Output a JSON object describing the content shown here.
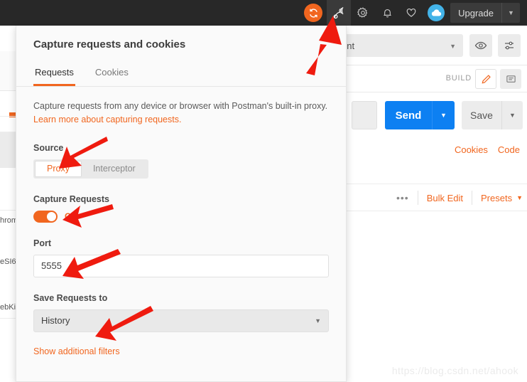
{
  "topbar": {
    "icons": [
      {
        "name": "sync-icon",
        "glyph": "sync"
      },
      {
        "name": "capture-requests-icon",
        "glyph": "satellite"
      },
      {
        "name": "settings-gear-icon",
        "glyph": "gear"
      },
      {
        "name": "notifications-bell-icon",
        "glyph": "bell"
      },
      {
        "name": "favorites-heart-icon",
        "glyph": "heart"
      },
      {
        "name": "account-avatar",
        "glyph": "cloud"
      }
    ],
    "upgrade_label": "Upgrade",
    "upgrade_caret": "▼",
    "colors": {
      "bar_bg": "#282828",
      "sync_orange": "#f1661f",
      "avatar_blue": "#43b3e8"
    }
  },
  "envbar": {
    "environment_text": "vironment",
    "caret": "▼",
    "eye_icon": "eye-icon",
    "sliders_icon": "sliders-icon"
  },
  "buildrow": {
    "build_label": "BUILD",
    "pencil_icon": "pencil-icon",
    "comment_icon": "comment-icon"
  },
  "sendrow": {
    "send_label": "Send",
    "send_caret": "▼",
    "save_label": "Save",
    "save_caret": "▼",
    "links": [
      "Cookies",
      "Code"
    ]
  },
  "paramsrow": {
    "dots": "•••",
    "bulk_edit": "Bulk Edit",
    "presets": "Presets",
    "presets_caret": "▼"
  },
  "left_sliver": {
    "fragments": [
      "hrom",
      "eSI6",
      "ebKit"
    ]
  },
  "modal": {
    "title": "Capture requests and cookies",
    "tabs": [
      {
        "label": "Requests",
        "selected": true
      },
      {
        "label": "Cookies",
        "selected": false
      }
    ],
    "description_prefix": "Capture requests from any device or browser with Postman's built-in proxy. ",
    "description_link": "Learn more about capturing requests.",
    "source": {
      "label": "Source",
      "options": [
        {
          "label": "Proxy",
          "selected": true
        },
        {
          "label": "Interceptor",
          "selected": false
        }
      ]
    },
    "capture_requests": {
      "label": "Capture Requests",
      "toggle_state": "ON"
    },
    "port": {
      "label": "Port",
      "value": "5555",
      "placeholder": "Port"
    },
    "save_requests_to": {
      "label": "Save Requests to",
      "value": "History",
      "caret": "▼"
    },
    "show_additional_filters": "Show additional filters",
    "accent_color": "#f1661f"
  },
  "watermark": "https://blog.csdn.net/ahook"
}
